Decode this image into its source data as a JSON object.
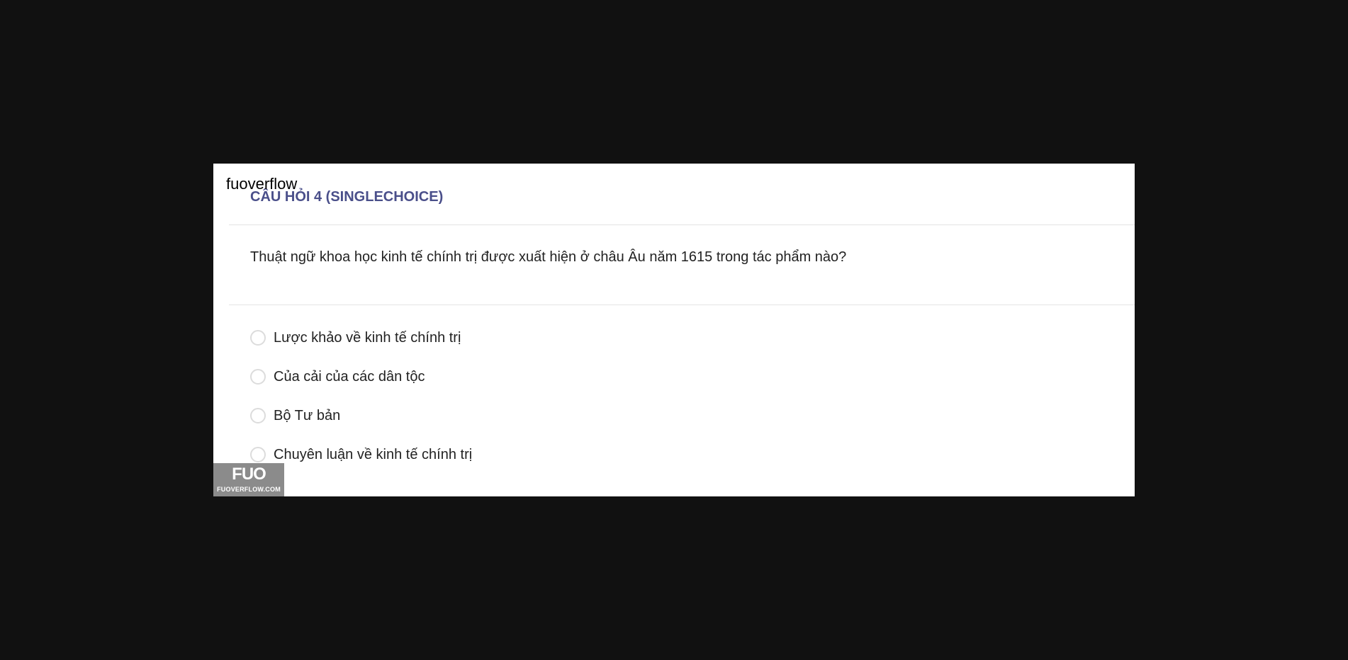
{
  "overlay": {
    "site_label": "fuoverflow"
  },
  "question": {
    "title": "CÂU HỎI 4 (SINGLECHOICE)",
    "text": "Thuật ngữ khoa học kinh tế chính trị được xuất hiện ở châu Âu năm 1615 trong tác phẩm nào?"
  },
  "options": [
    {
      "label": "Lược khảo về kinh tế chính trị"
    },
    {
      "label": "Của cải của các dân tộc"
    },
    {
      "label": "Bộ Tư bản"
    },
    {
      "label": "Chuyên luận về kinh tế chính trị"
    }
  ],
  "watermark": {
    "logo_text": "FUO",
    "site": "FUOVERFLOW.COM"
  },
  "colors": {
    "background": "#111111",
    "card": "#ffffff",
    "title_accent": "#4a4f8a",
    "logo_badge": "#8b8b8b"
  }
}
